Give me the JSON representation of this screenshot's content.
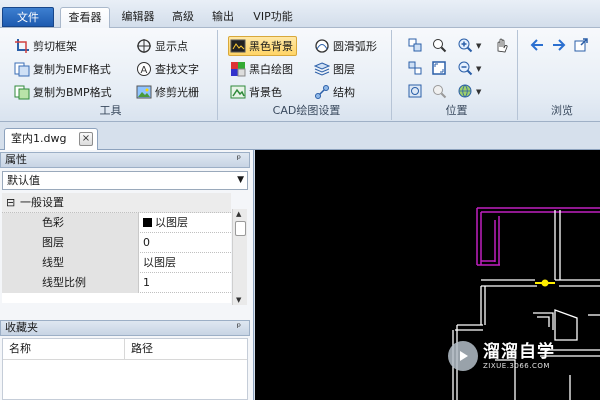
{
  "menu": {
    "tabs": [
      "文件",
      "查看器",
      "编辑器",
      "高级",
      "输出",
      "VIP功能"
    ],
    "active": "查看器"
  },
  "ribbon": {
    "tools": {
      "label": "工具",
      "items": [
        "剪切框架",
        "复制为EMF格式",
        "复制为BMP格式",
        "显示点",
        "查找文字",
        "修剪光栅"
      ]
    },
    "cad": {
      "label": "CAD绘图设置",
      "items": [
        "黑色背景",
        "黑白绘图",
        "背景色",
        "圆滑弧形",
        "图层",
        "结构"
      ],
      "highlighted": "黑色背景"
    },
    "position": {
      "label": "位置"
    },
    "browse": {
      "label": "浏览"
    }
  },
  "document_tab": {
    "name": "室内1.dwg",
    "close": "×"
  },
  "properties_panel": {
    "title": "属性",
    "pin": "ᵖ",
    "combo_value": "默认值",
    "category": "一般设置",
    "category_toggle": "⊟",
    "rows": [
      {
        "name": "色彩",
        "value": "以图层"
      },
      {
        "name": "图层",
        "value": "0"
      },
      {
        "name": "线型",
        "value": "以图层"
      },
      {
        "name": "线型比例",
        "value": "1"
      }
    ]
  },
  "favorites_panel": {
    "title": "收藏夹",
    "pin": "ᵖ",
    "columns": [
      "名称",
      "路径"
    ]
  },
  "watermark": {
    "title": "溜溜自学",
    "subtitle": "ZIXUE.3066.COM"
  },
  "colors": {
    "canvas_bg": "#000000",
    "magenta_line": "#c020c0",
    "white_line": "#ffffff",
    "yellow_mark": "#ffee00"
  }
}
